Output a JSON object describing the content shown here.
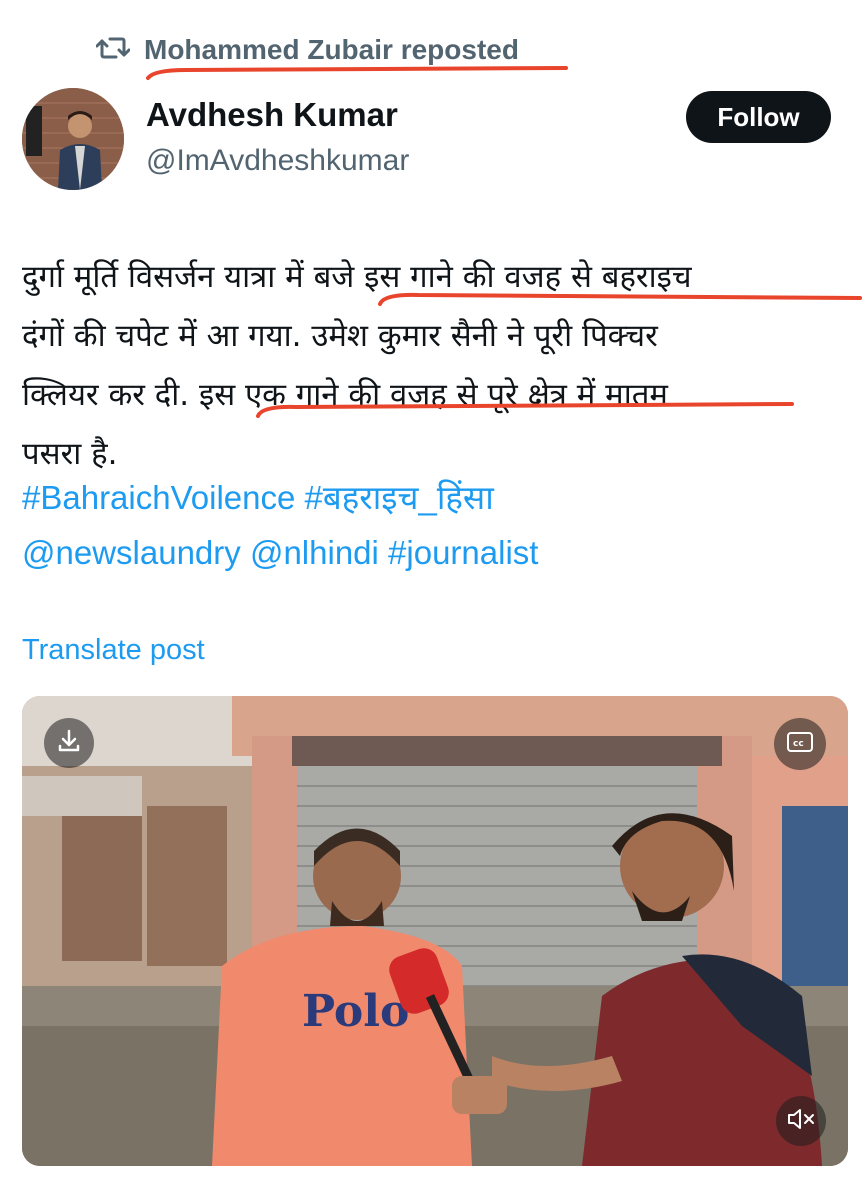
{
  "repost": {
    "icon": "repost-icon",
    "text": "Mohammed Zubair reposted"
  },
  "author": {
    "name": "Avdhesh Kumar",
    "handle": "@ImAvdheshkumar",
    "avatar_icon": "avatar"
  },
  "follow_label": "Follow",
  "post": {
    "lines": [
      "दुर्गा मूर्ति विसर्जन यात्रा में बजे इस गाने की वजह से बहराइच",
      "दंगों की चपेट में आ गया. उमेश कुमार सैनी ने पूरी पिक्चर",
      "क्लियर कर दी. इस एक गाने की वज़ह से पूरे क्षेत्र में मातम",
      "पसरा है."
    ],
    "tags_line1": [
      "#BahraichVoilence",
      "#बहराइच_हिंसा"
    ],
    "tags_line2": [
      "@newslaundry",
      "@nlhindi",
      "#journalist"
    ]
  },
  "translate_label": "Translate post",
  "media": {
    "download_icon": "download-icon",
    "captions_icon": "cc-icon",
    "mute_icon": "mute-icon",
    "shirt_text": "Polo"
  },
  "colors": {
    "accent": "#1d9bf0",
    "highlight": "#e8452c",
    "text": "#0f1419",
    "muted": "#536471"
  }
}
